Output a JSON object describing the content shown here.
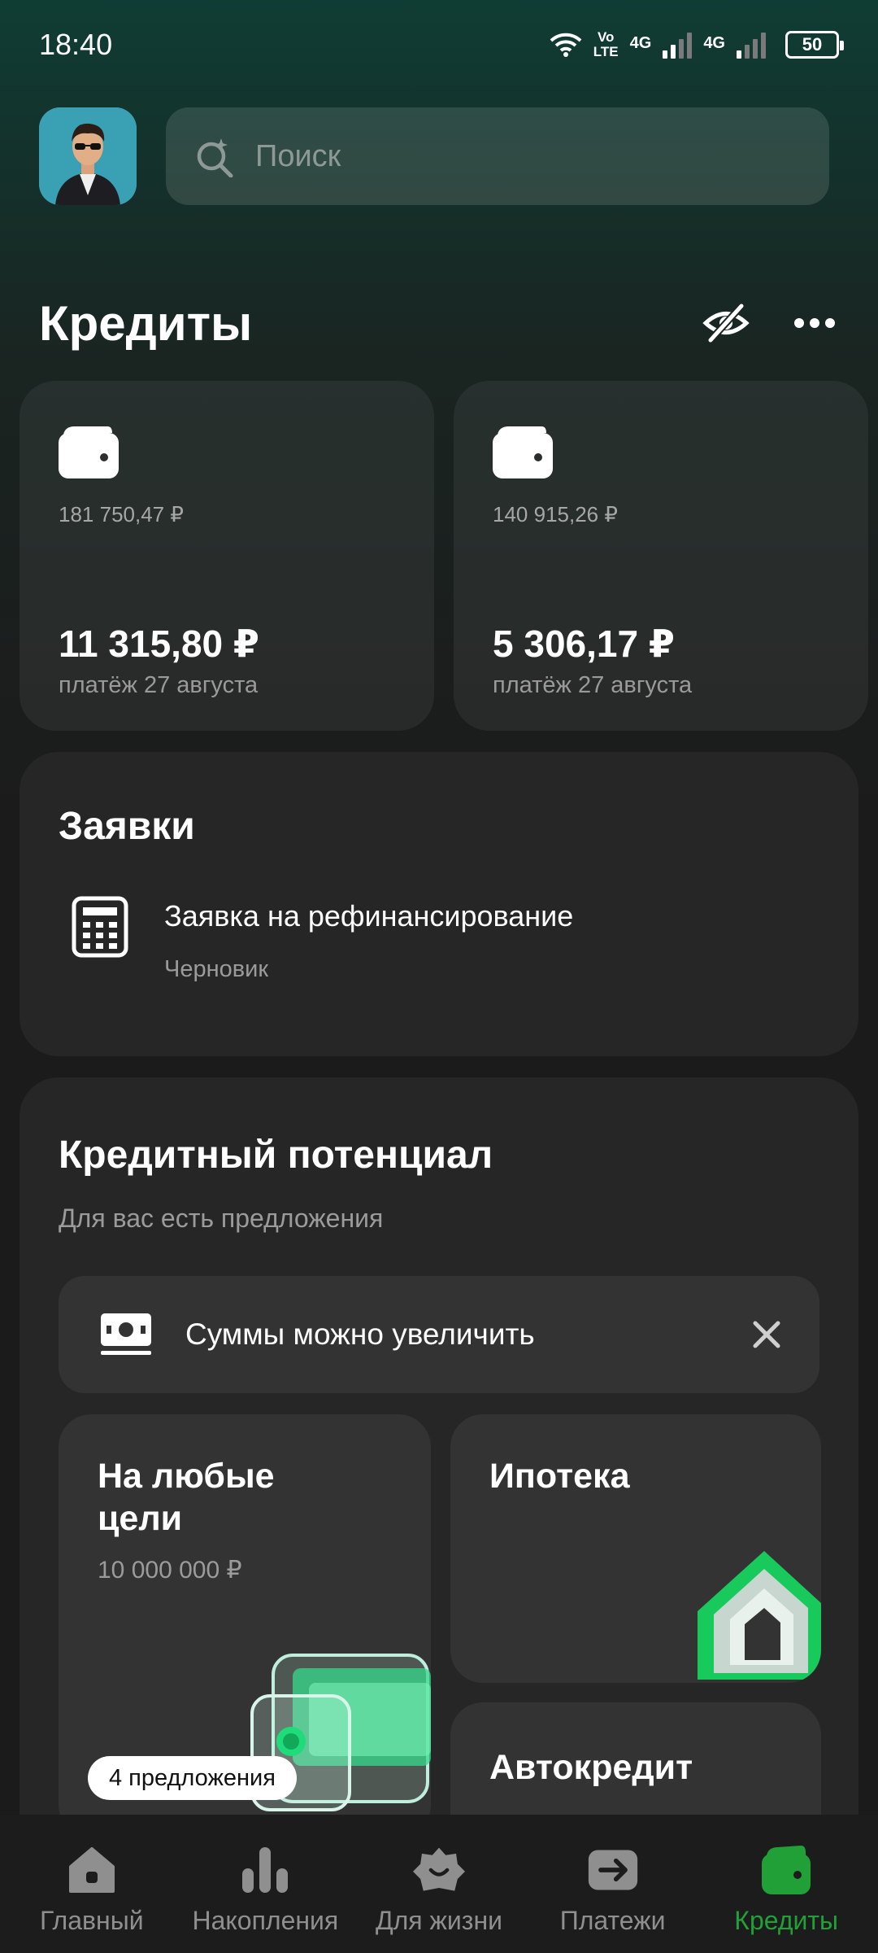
{
  "status_bar": {
    "time": "18:40",
    "volte_top": "Vo",
    "volte_bottom": "LTE",
    "net1": "4G",
    "net2": "4G",
    "battery": "50"
  },
  "header": {
    "search_placeholder": "Поиск"
  },
  "page": {
    "title": "Кредиты"
  },
  "credits": [
    {
      "debt": "181 750,47 ₽",
      "payment": "11 315,80 ₽",
      "payment_date": "платёж 27 августа"
    },
    {
      "debt": "140 915,26 ₽",
      "payment": "5 306,17 ₽",
      "payment_date": "платёж 27 августа"
    }
  ],
  "applications": {
    "title": "Заявки",
    "items": [
      {
        "name": "Заявка на рефинансирование",
        "status": "Черновик"
      }
    ]
  },
  "potential": {
    "title": "Кредитный потенциал",
    "subtitle": "Для вас есть предложения",
    "increase_label": "Суммы можно увеличить",
    "offers": {
      "any_purpose": {
        "title_line1": "На любые",
        "title_line2": "цели",
        "amount": "10 000 000 ₽",
        "badge": "4 предложения"
      },
      "mortgage": {
        "title": "Ипотека"
      },
      "auto": {
        "title": "Автокредит"
      }
    }
  },
  "bottom_nav": {
    "items": [
      {
        "label": "Главный"
      },
      {
        "label": "Накопления"
      },
      {
        "label": "Для жизни"
      },
      {
        "label": "Платежи"
      },
      {
        "label": "Кредиты"
      }
    ],
    "active_color": "#21a038"
  }
}
